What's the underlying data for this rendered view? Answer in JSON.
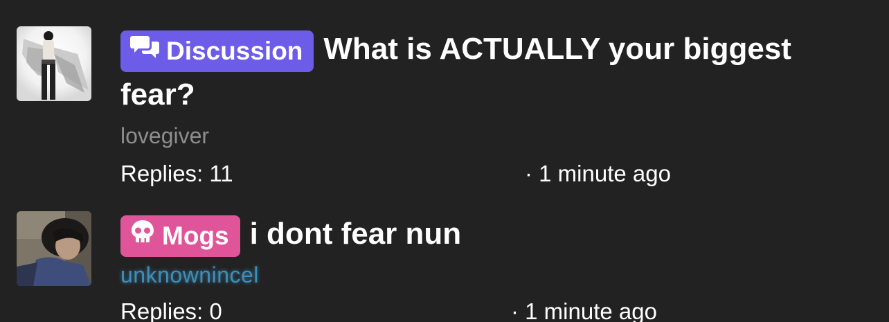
{
  "threads": [
    {
      "tag": {
        "label": "Discussion",
        "icon": "chat-bubbles-icon",
        "color": "#6c5ce7"
      },
      "title": "What is ACTUALLY your biggest fear?",
      "author": "lovegiver",
      "replies": "Replies: 11",
      "time": "· 1 minute ago",
      "avatar": "angel-wings-avatar"
    },
    {
      "tag": {
        "label": "Mogs",
        "icon": "skull-icon",
        "color": "#e0559a"
      },
      "title": "i dont fear nun",
      "author": "unknownincel",
      "replies": "Replies: 0",
      "time": "· 1 minute ago",
      "avatar": "person-photo-avatar"
    }
  ],
  "colors": {
    "background": "#222222",
    "author_gray": "#8e8e8e",
    "author_glow": "#3d8fb8"
  }
}
